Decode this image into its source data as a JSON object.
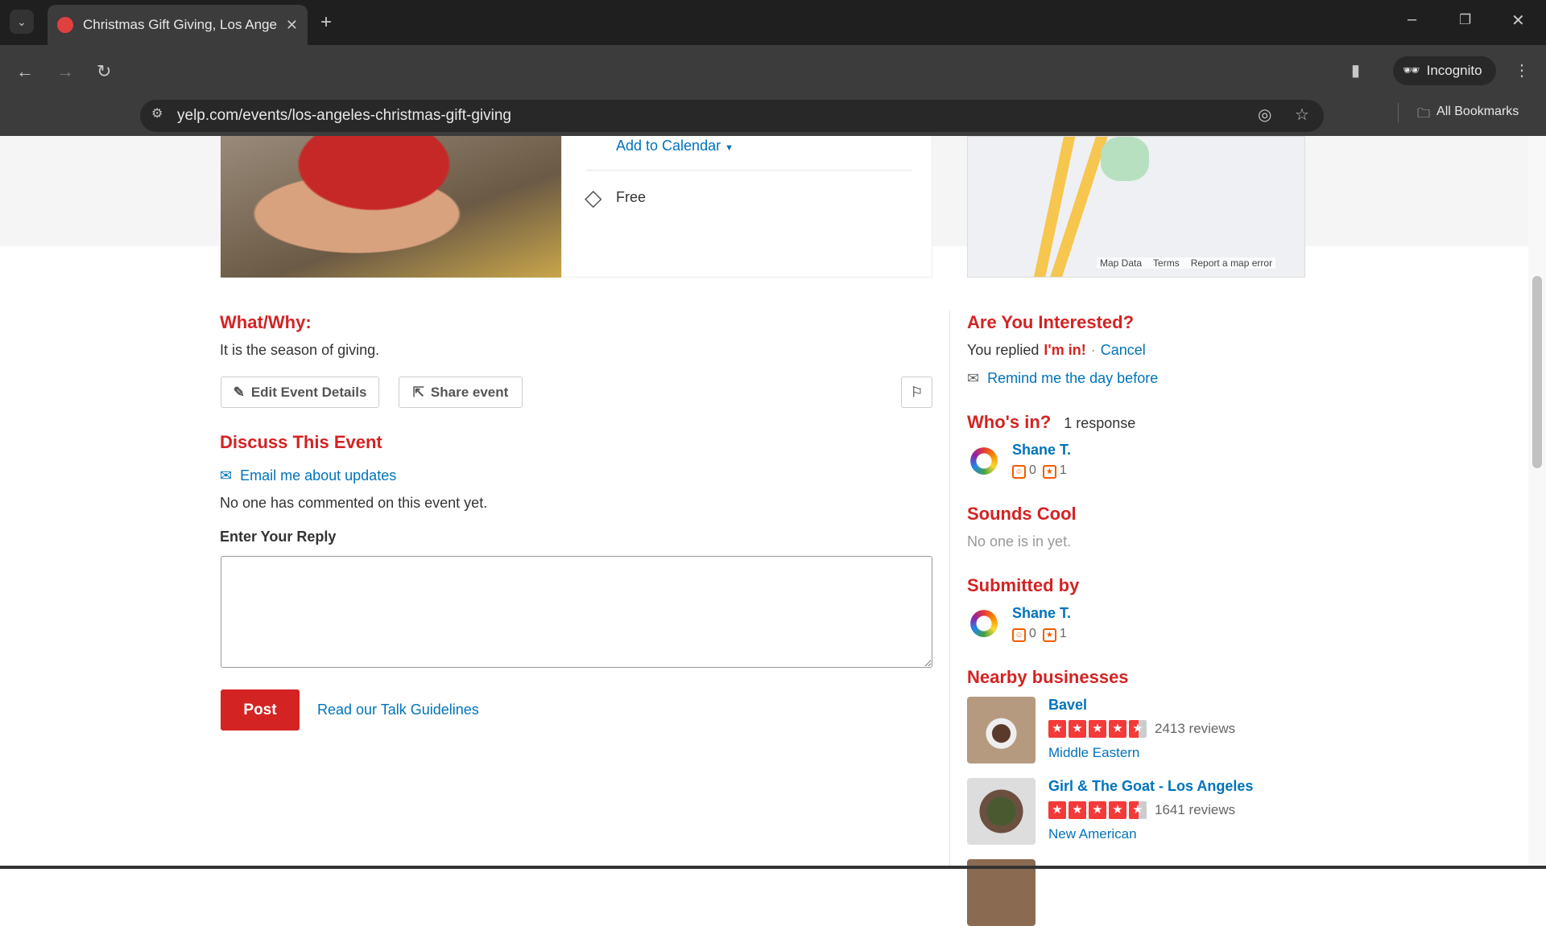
{
  "browser": {
    "tab_title": "Christmas Gift Giving, Los Ange",
    "url": "yelp.com/events/los-angeles-christmas-gift-giving",
    "incognito_label": "Incognito",
    "bookmarks_label": "All Bookmarks"
  },
  "event": {
    "add_to_calendar": "Add to Calendar",
    "price": "Free",
    "map_labels": {
      "map_data": "Map Data",
      "terms": "Terms",
      "report": "Report a map error"
    },
    "what_why_heading": "What/Why:",
    "what_why_text": "It is the season of giving.",
    "edit_button": "Edit Event Details",
    "share_button": "Share event"
  },
  "discussion": {
    "heading": "Discuss This Event",
    "email_link": "Email me about updates",
    "no_comments": "No one has commented on this event yet.",
    "reply_label": "Enter Your Reply",
    "reply_value": "",
    "post_button": "Post",
    "guidelines_link": "Read our Talk Guidelines"
  },
  "sidebar": {
    "interested_heading": "Are You Interested?",
    "replied_prefix": "You replied",
    "replied_value": "I'm in!",
    "separator": "·",
    "cancel": "Cancel",
    "remind": "Remind me the day before",
    "whos_in_heading": "Who's in?",
    "whos_in_count": "1 response",
    "whos_in_user": {
      "name": "Shane T.",
      "friends": "0",
      "reviews": "1"
    },
    "sounds_cool_heading": "Sounds Cool",
    "sounds_cool_text": "No one is in yet.",
    "submitted_heading": "Submitted by",
    "submitted_user": {
      "name": "Shane T.",
      "friends": "0",
      "reviews": "1"
    },
    "nearby_heading": "Nearby businesses",
    "nearby": [
      {
        "name": "Bavel",
        "rating": 4.5,
        "reviews": "2413 reviews",
        "category": "Middle Eastern"
      },
      {
        "name": "Girl & The Goat - Los Angeles",
        "rating": 4.5,
        "reviews": "1641 reviews",
        "category": "New American"
      }
    ]
  },
  "colors": {
    "brand_red": "#d32323",
    "link_blue": "#0073bb",
    "star_red": "#f43939"
  }
}
